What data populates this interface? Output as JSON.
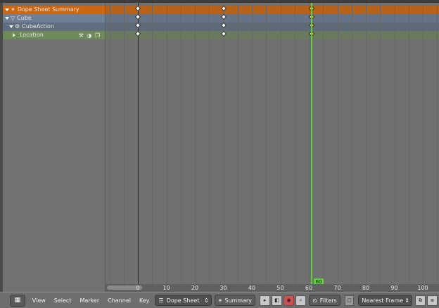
{
  "channels": [
    {
      "label": "Dope Sheet Summary",
      "icon": "dopesheet-summary-icon",
      "bg": "#cc6611"
    },
    {
      "label": "Cube",
      "icon": "object-icon",
      "bg": "#6f7f96"
    },
    {
      "label": "CubeAction",
      "icon": "action-icon",
      "bg": "#5f6f80"
    },
    {
      "label": "Location",
      "icon": "fcurve-icon",
      "bg": "#6e8a5a"
    }
  ],
  "channel_tools": "⚒ ◑ ❐",
  "timeline": {
    "ticks": [
      "0",
      "10",
      "20",
      "30",
      "40",
      "50",
      "60",
      "70",
      "80",
      "90",
      "100"
    ],
    "current_frame": "60",
    "keyframe_frames": [
      0,
      30,
      61
    ]
  },
  "header": {
    "editor_icon": "▦",
    "menus": [
      "View",
      "Select",
      "Marker",
      "Channel",
      "Key"
    ],
    "mode": "Dope Sheet",
    "summary_label": "Summary",
    "filters_label": "Filters",
    "snap_mode": "Nearest Frame"
  },
  "colors": {
    "playhead": "#5fce3c",
    "summary_row": "#cc6611",
    "selected_keyframe": "#f0d84a"
  }
}
